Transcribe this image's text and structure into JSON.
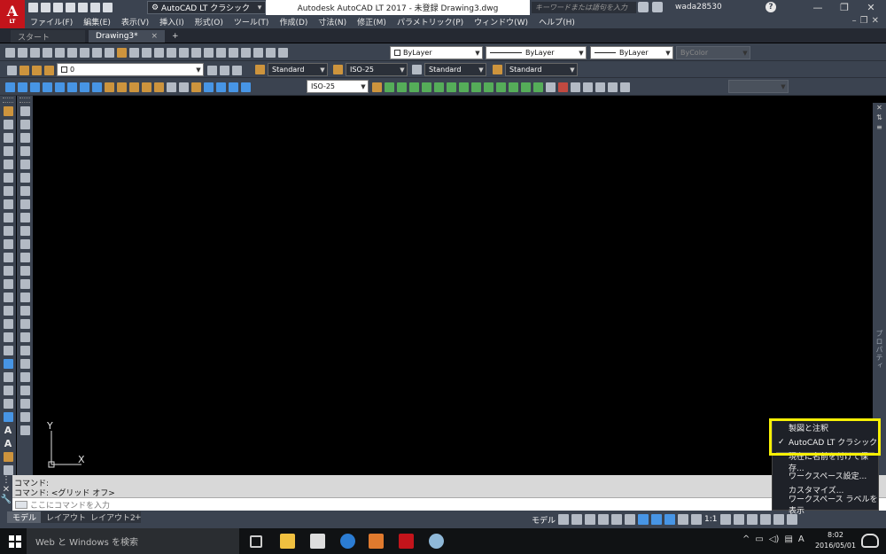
{
  "app": {
    "logo_letter": "A",
    "logo_sub": "LT",
    "window_title": "Autodesk AutoCAD LT 2017 - 未登録   Drawing3.dwg",
    "workspace_selected": "AutoCAD LT クラシック",
    "search_placeholder": "キーワードまたは語句を入力",
    "username": "wada28530"
  },
  "menubar": {
    "items": [
      "ファイル(F)",
      "編集(E)",
      "表示(V)",
      "挿入(I)",
      "形式(O)",
      "ツール(T)",
      "作成(D)",
      "寸法(N)",
      "修正(M)",
      "パラメトリック(P)",
      "ウィンドウ(W)",
      "ヘルプ(H)"
    ]
  },
  "tabs": {
    "start": "スタート",
    "drawing": "Drawing3*",
    "close": "×",
    "add": "+"
  },
  "toolbars": {
    "layer_color": "ByLayer",
    "linetype": "ByLayer",
    "lineweight": "ByLayer",
    "plot_style": "ByColor",
    "layer_name": "0",
    "text_style": "Standard",
    "dim_style": "ISO-25",
    "table_style": "Standard",
    "mleader_style": "Standard",
    "dim_style_2": "ISO-25"
  },
  "drawing": {
    "ucs_y": "Y",
    "ucs_x": "X",
    "props_label": "プロパティ"
  },
  "command": {
    "line1": "コマンド:",
    "line2": "コマンド:  <グリッド オフ>",
    "placeholder": "ここにコマンドを入力"
  },
  "layout_tabs": [
    "モデル",
    "レイアウト1",
    "レイアウト2"
  ],
  "layout_add": "+",
  "status": {
    "model": "モデル",
    "scale": "1:1"
  },
  "workspace_menu": {
    "items": [
      {
        "label": "製図と注釈",
        "checked": false
      },
      {
        "label": "AutoCAD LT クラシック",
        "checked": true
      },
      {
        "label": "現在に名前を付けて保存...",
        "checked": false
      },
      {
        "label": "ワークスペース設定...",
        "checked": false
      },
      {
        "label": "カスタマイズ...",
        "checked": false
      },
      {
        "label": "ワークスペース ラベルを表示",
        "checked": false
      }
    ],
    "check_mark": "✓"
  },
  "taskbar": {
    "search": "Web と Windows を検索",
    "time": "8:02",
    "date": "2016/05/01",
    "ime": "A"
  },
  "colors": {
    "highlight": "#f7f005",
    "panel": "#3b4350",
    "logo": "#c3141b"
  }
}
